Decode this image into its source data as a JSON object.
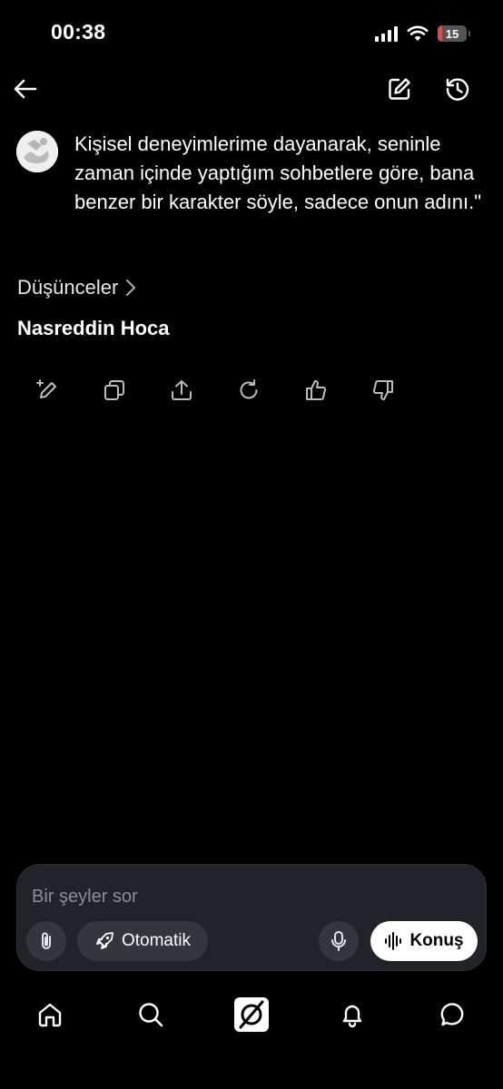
{
  "status_bar": {
    "time": "00:38",
    "battery_level": "15",
    "battery_color": "#e5484d"
  },
  "top_nav": {
    "back_icon": "arrow-left-icon",
    "new_chat_icon": "compose-icon",
    "history_icon": "history-icon"
  },
  "conversation": {
    "user_message": "Kişisel deneyimlerime dayanarak, seninle zaman içinde yaptığım sohbetlere göre, bana benzer bir karakter söyle, sadece onun adını.\"",
    "thoughts_label": "Düşünceler",
    "answer": "Nasreddin Hoca",
    "actions": [
      "edit-sparkle-icon",
      "copy-icon",
      "share-icon",
      "regenerate-icon",
      "thumbs-up-icon",
      "thumbs-down-icon"
    ]
  },
  "composer": {
    "placeholder": "Bir şeyler sor",
    "mode_label": "Otomatik",
    "voice_label": "Konuş"
  },
  "tab_bar": {
    "items": [
      "home-icon",
      "search-icon",
      "grok-icon",
      "bell-icon",
      "chat-bubble-icon"
    ]
  },
  "colors": {
    "background": "#000000",
    "composer_bg": "#202327",
    "chip_bg": "#33373d",
    "text_primary": "#ffffff",
    "placeholder": "#8b8f95"
  }
}
